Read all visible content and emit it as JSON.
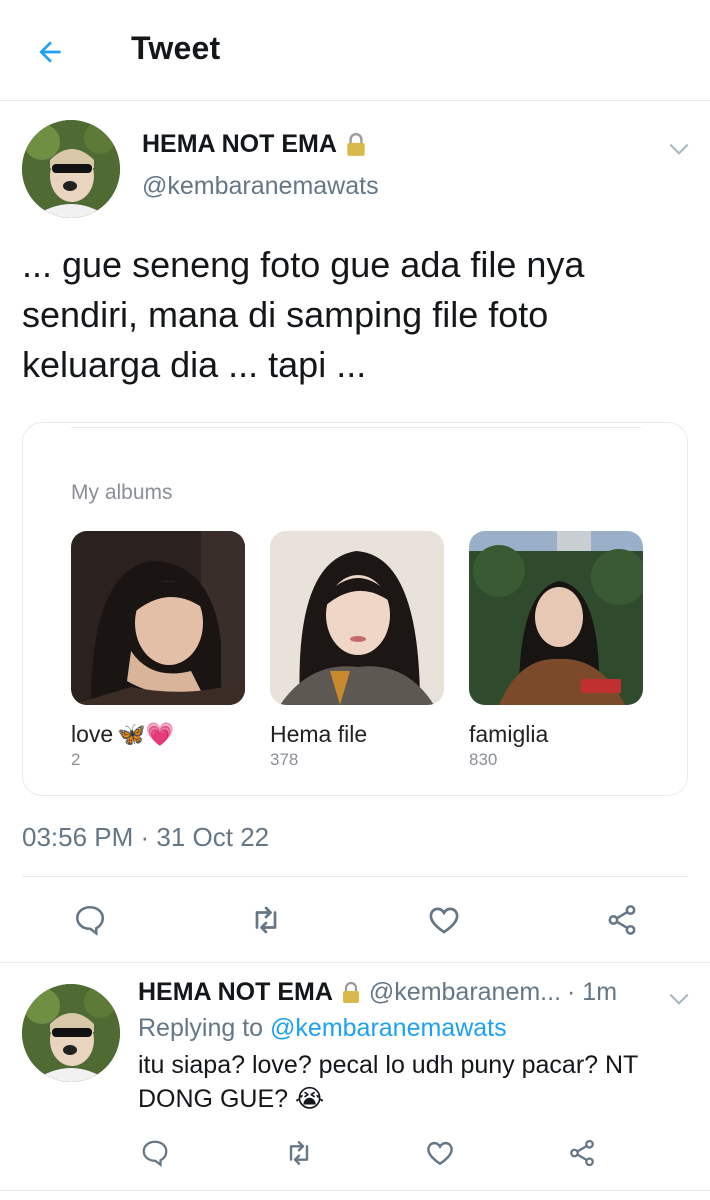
{
  "header": {
    "title": "Tweet"
  },
  "tweet": {
    "author_name": "HEMA NOT EMA",
    "author_handle": "@kembaranemawats",
    "text": "... gue seneng foto gue ada file nya sendiri, mana di samping file foto keluarga dia ... tapi ...",
    "timestamp": "03:56 PM · 31 Oct 22"
  },
  "card": {
    "title": "My albums",
    "albums": [
      {
        "name": "love",
        "emoji": "🦋💗",
        "count": "2"
      },
      {
        "name": "Hema file",
        "count": "378"
      },
      {
        "name": "famiglia",
        "count": "830"
      }
    ]
  },
  "reply": {
    "author_name": "HEMA NOT EMA",
    "author_handle": "@kembaranem...",
    "time": "· 1m",
    "replying_label": "Replying to",
    "replying_handle": "@kembaranemawats",
    "text": "itu siapa? love? pecal lo udh puny pacar? NT DONG GUE? 😭"
  },
  "colors": {
    "accent": "#1da1f2",
    "text": "#14171a",
    "muted": "#657786",
    "divider": "#e6ecf0"
  },
  "icons": [
    "back-arrow-icon",
    "lock-icon",
    "chevron-down-icon",
    "reply-icon",
    "retweet-icon",
    "like-icon",
    "share-icon"
  ]
}
